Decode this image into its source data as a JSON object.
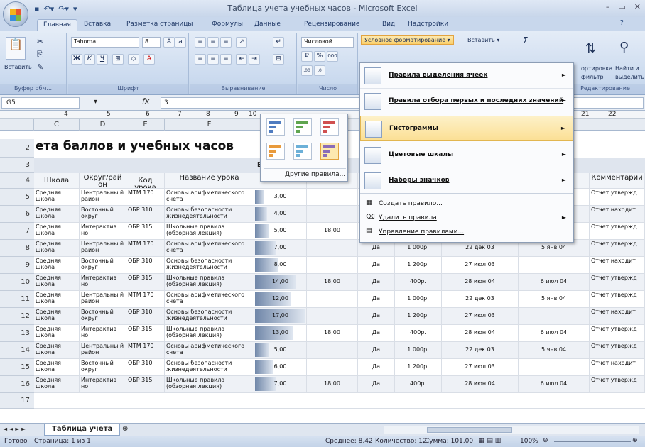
{
  "window": {
    "title": "Таблица учета учебных часов - Microsoft Excel"
  },
  "tabs": [
    "Главная",
    "Вставка",
    "Разметка страницы",
    "Формулы",
    "Данные",
    "Рецензирование",
    "Вид",
    "Надстройки"
  ],
  "ribbon": {
    "paste": "Вставить",
    "clipboard": "Буфер обм...",
    "font_name": "Tahoma",
    "font_size": "8",
    "font_group": "Шрифт",
    "align_group": "Выравнивание",
    "number_format": "Числовой",
    "number_group": "Число",
    "cond_format": "Условное форматирование",
    "insert": "Вставить",
    "sort": "ортировка",
    "sort2": "фильтр",
    "find": "Найти и",
    "find2": "выделить",
    "edit_group": "Редактирование",
    "sigma": "Σ"
  },
  "formula": {
    "cell": "G5",
    "fx": "fx",
    "value": "3"
  },
  "ruler_marks": [
    "4",
    "5",
    "6",
    "7",
    "8",
    "9",
    "10",
    "21",
    "22"
  ],
  "columns": [
    "C",
    "D",
    "E",
    "F"
  ],
  "sheet": {
    "title": "ета баллов и учебных часов",
    "row3_frag": "Б",
    "headers": [
      "Школа",
      "Округ/рай он",
      "Код урока",
      "Название урока",
      "Баллы",
      "Часы",
      "Да",
      "",
      "",
      "ят",
      "Комментарии"
    ],
    "rows": [
      [
        "Средняя школа",
        "Центральны й район",
        "МТМ 170",
        "Основы арифметического счета",
        "3,00",
        "",
        "",
        "",
        "",
        "",
        "Отчет утвержд"
      ],
      [
        "Средняя школа",
        "Восточный округ",
        "ОБР 310",
        "Основы безопасности жизнедеятельности",
        "4,00",
        "",
        "",
        "",
        "",
        "",
        "Отчет находит"
      ],
      [
        "Средняя школа",
        "Интерактив но",
        "ОБР 315",
        "Школьные правила (обзорная лекция)",
        "5,00",
        "18,00",
        "",
        "",
        "",
        "",
        "Отчет утвержд"
      ],
      [
        "Средняя школа",
        "Центральны й район",
        "МТМ 170",
        "Основы арифметического счета",
        "7,00",
        "",
        "Да",
        "1 000р.",
        "22 дек 03",
        "5 янв 04",
        "Отчет утвержд"
      ],
      [
        "Средняя школа",
        "Восточный округ",
        "ОБР 310",
        "Основы безопасности жизнедеятельности",
        "8,00",
        "",
        "Да",
        "1 200р.",
        "27 июл 03",
        "",
        "Отчет находит"
      ],
      [
        "Средняя школа",
        "Интерактив но",
        "ОБР 315",
        "Школьные правила (обзорная лекция)",
        "14,00",
        "18,00",
        "Да",
        "400р.",
        "28 июн 04",
        "6 июл 04",
        "Отчет утвержд"
      ],
      [
        "Средняя школа",
        "Центральны й район",
        "МТМ 170",
        "Основы арифметического счета",
        "12,00",
        "",
        "Да",
        "1 000р.",
        "22 дек 03",
        "5 янв 04",
        "Отчет утвержд"
      ],
      [
        "Средняя школа",
        "Восточный округ",
        "ОБР 310",
        "Основы безопасности жизнедеятельности",
        "17,00",
        "",
        "Да",
        "1 200р.",
        "27 июл 03",
        "",
        "Отчет находит"
      ],
      [
        "Средняя школа",
        "Интерактив но",
        "ОБР 315",
        "Школьные правила (обзорная лекция)",
        "13,00",
        "18,00",
        "Да",
        "400р.",
        "28 июн 04",
        "6 июл 04",
        "Отчет утвержд"
      ],
      [
        "Средняя школа",
        "Центральны й район",
        "МТМ 170",
        "Основы арифметического счета",
        "5,00",
        "",
        "Да",
        "1 000р.",
        "22 дек 03",
        "5 янв 04",
        "Отчет утвержд"
      ],
      [
        "Средняя школа",
        "Восточный округ",
        "ОБР 310",
        "Основы безопасности жизнедеятельности",
        "6,00",
        "",
        "Да",
        "1 200р.",
        "27 июл 03",
        "",
        "Отчет находит"
      ],
      [
        "Средняя школа",
        "Интерактив но",
        "ОБР 315",
        "Школьные правила (обзорная лекция)",
        "7,00",
        "18,00",
        "Да",
        "400р.",
        "28 июн 04",
        "6 июл 04",
        "Отчет утвержд"
      ]
    ],
    "score_fraction": [
      0.18,
      0.24,
      0.29,
      0.41,
      0.47,
      0.82,
      0.71,
      1.0,
      0.76,
      0.29,
      0.35,
      0.41
    ],
    "row_numbers": [
      "2",
      "3",
      "4",
      "5",
      "6",
      "7",
      "8",
      "9",
      "10",
      "11",
      "12",
      "13",
      "14",
      "15",
      "16",
      "17"
    ]
  },
  "cf_menu": {
    "items": [
      "Правила выделения ячеек",
      "Правила отбора первых и последних значений",
      "Гистограммы",
      "Цветовые шкалы",
      "Наборы значков"
    ],
    "actions": [
      "Создать правило...",
      "Удалить правила",
      "Управление правилами..."
    ]
  },
  "gallery": {
    "more": "Другие правила..."
  },
  "sheet_tab": "Таблица учета",
  "status": {
    "ready": "Готово",
    "page": "Страница: 1 из 1",
    "avg": "Среднее: 8,42",
    "count": "Количество: 12",
    "sum": "Сумма: 101,00",
    "zoom": "100%"
  },
  "colors": {
    "databar": "#6f86a8",
    "ribbon": "#c9d9ee"
  }
}
